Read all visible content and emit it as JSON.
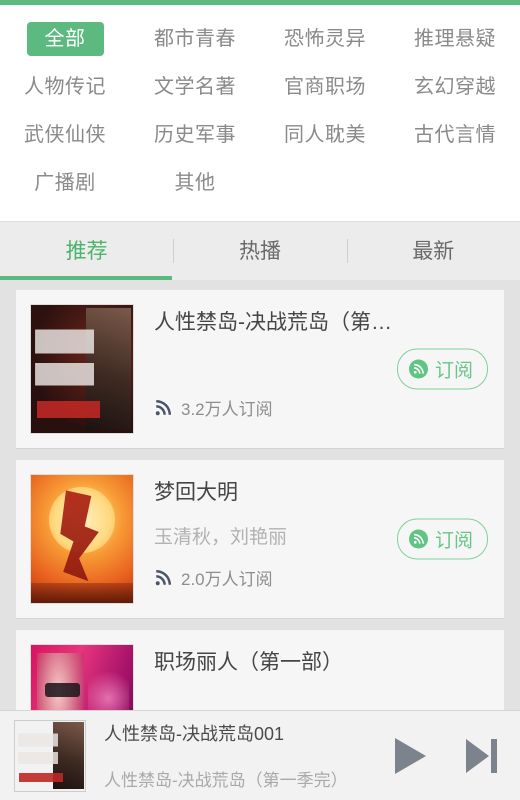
{
  "theme": {
    "accent": "#5cb97f",
    "accent_text": "#4cb36a",
    "page_bg": "#e2e2e2",
    "card_bg": "#f6f6f6",
    "title_color": "#454545",
    "muted_color": "#b2b2b2"
  },
  "categories": {
    "items": [
      {
        "label": "全部",
        "active": true
      },
      {
        "label": "都市青春",
        "active": false
      },
      {
        "label": "恐怖灵异",
        "active": false
      },
      {
        "label": "推理悬疑",
        "active": false
      },
      {
        "label": "人物传记",
        "active": false
      },
      {
        "label": "文学名著",
        "active": false
      },
      {
        "label": "官商职场",
        "active": false
      },
      {
        "label": "玄幻穿越",
        "active": false
      },
      {
        "label": "武侠仙侠",
        "active": false
      },
      {
        "label": "历史军事",
        "active": false
      },
      {
        "label": "同人耽美",
        "active": false
      },
      {
        "label": "古代言情",
        "active": false
      },
      {
        "label": "广播剧",
        "active": false
      },
      {
        "label": "其他",
        "active": false
      }
    ]
  },
  "tabs": {
    "items": [
      {
        "label": "推荐",
        "active": true
      },
      {
        "label": "热播",
        "active": false
      },
      {
        "label": "最新",
        "active": false
      }
    ]
  },
  "list": {
    "items": [
      {
        "title": "人性禁岛-决战荒岛（第…",
        "author": "",
        "subscribers": "3.2万人订阅",
        "subscribe_label": "订阅",
        "cover_class": "cv1",
        "cover_name": "book-cover-renxing-jindao"
      },
      {
        "title": "梦回大明",
        "author": "玉清秋，刘艳丽",
        "subscribers": "2.0万人订阅",
        "subscribe_label": "订阅",
        "cover_class": "cv2",
        "cover_name": "book-cover-menghui-daming"
      },
      {
        "title": "职场丽人（第一部）",
        "author": "",
        "subscribers": "",
        "subscribe_label": "",
        "cover_class": "cv3",
        "cover_name": "book-cover-zhichang-liren"
      }
    ]
  },
  "player": {
    "track_title": "人性禁岛-决战荒岛001",
    "album_title": "人性禁岛-决战荒岛（第一季完）",
    "play_icon": "play-icon",
    "next_icon": "next-track-icon"
  },
  "icons": {
    "rss": "rss-icon",
    "subscribe_badge": "rss-badge-icon"
  }
}
